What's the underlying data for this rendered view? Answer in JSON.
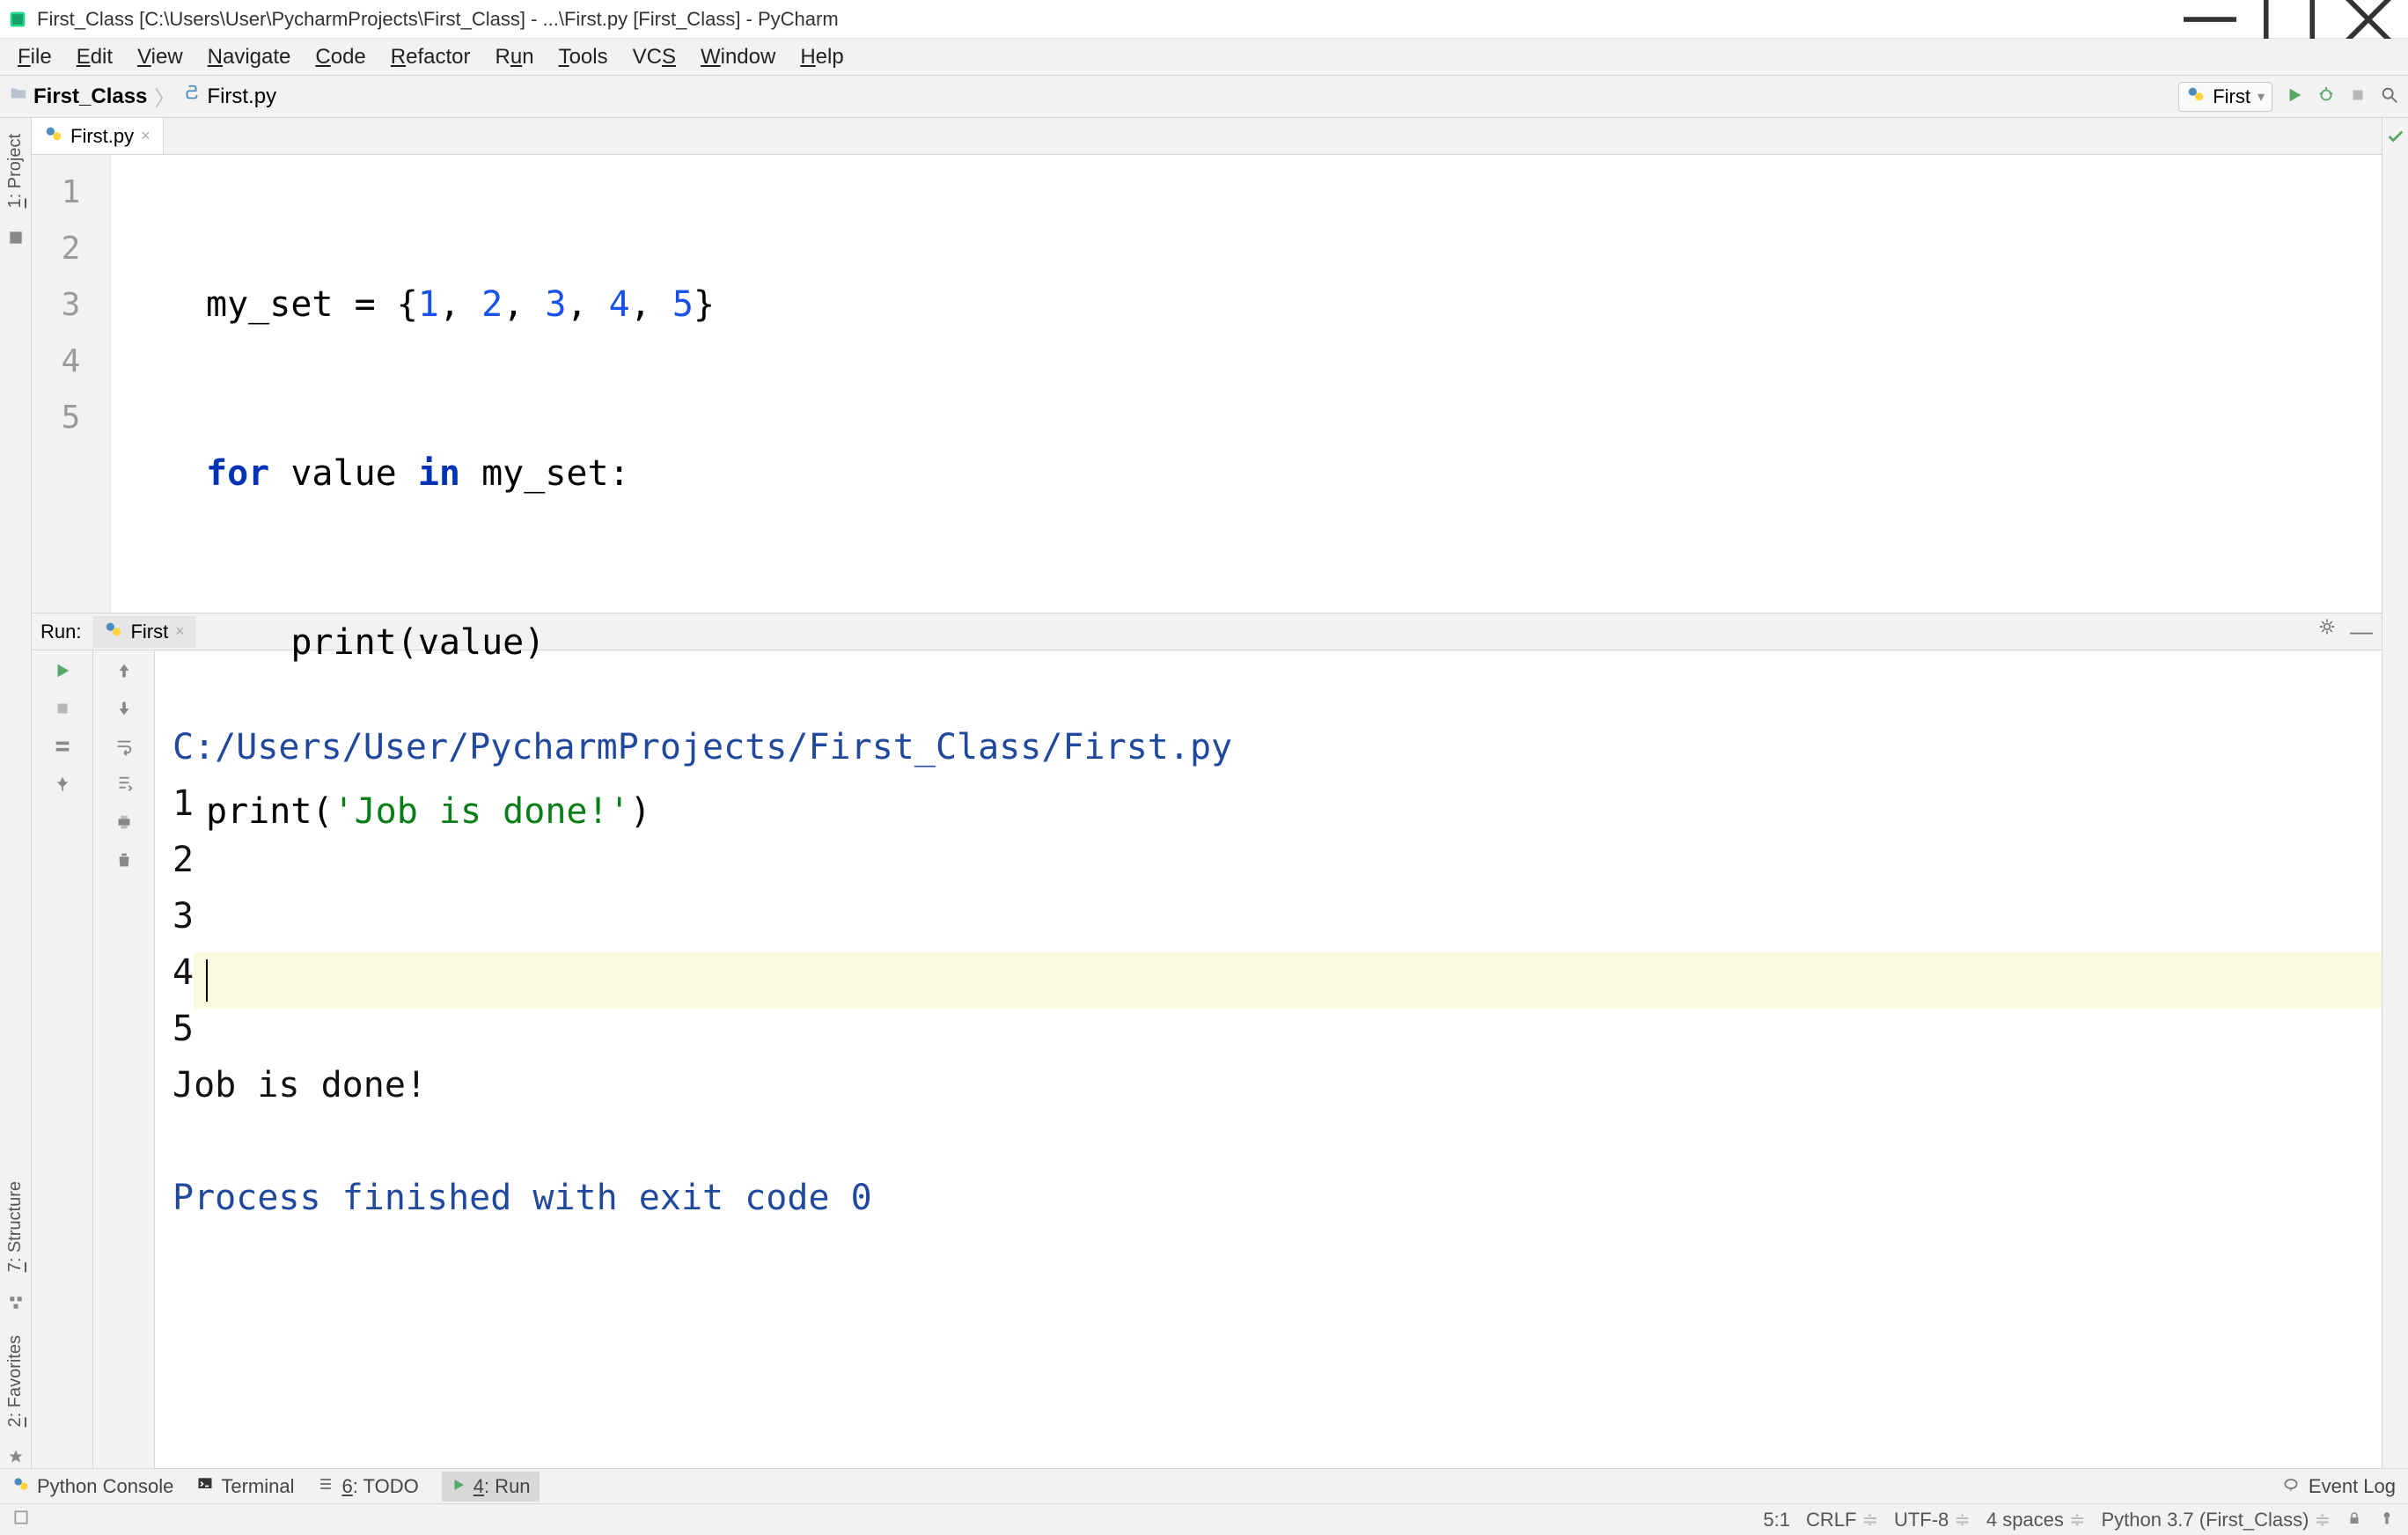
{
  "window": {
    "title": "First_Class [C:\\Users\\User\\PycharmProjects\\First_Class] - ...\\First.py [First_Class] - PyCharm"
  },
  "menu": {
    "file": "File",
    "edit": "Edit",
    "view": "View",
    "navigate": "Navigate",
    "code": "Code",
    "refactor": "Refactor",
    "run": "Run",
    "tools": "Tools",
    "vcs": "VCS",
    "window": "Window",
    "help": "Help"
  },
  "breadcrumb": {
    "project": "First_Class",
    "file": "First.py"
  },
  "run_config": {
    "name": "First"
  },
  "left_tabs": {
    "project": "1: Project",
    "structure": "7: Structure",
    "favorites": "2: Favorites"
  },
  "editor": {
    "tab": "First.py",
    "lines": {
      "n1": "1",
      "n2": "2",
      "n3": "3",
      "n4": "4",
      "n5": "5"
    },
    "code": {
      "l1_a": "my_set = {",
      "l1_n1": "1",
      "l1_c": ", ",
      "l1_n2": "2",
      "l1_n3": "3",
      "l1_n4": "4",
      "l1_n5": "5",
      "l1_b": "}",
      "l2_for": "for",
      "l2_val": " value ",
      "l2_in": "in",
      "l2_rest": " my_set:",
      "l3": "    print(value)",
      "l4_a": "print(",
      "l4_s": "'Job is done!'",
      "l4_b": ")"
    }
  },
  "run_panel": {
    "label": "Run:",
    "tab": "First",
    "output": {
      "path": "C:/Users/User/PycharmProjects/First_Class/First.py",
      "o1": "1",
      "o2": "2",
      "o3": "3",
      "o4": "4",
      "o5": "5",
      "o6": "Job is done!",
      "proc": "Process finished with exit code 0"
    }
  },
  "bottom": {
    "python_console": "Python Console",
    "terminal": "Terminal",
    "todo": "6: TODO",
    "run": "4: Run",
    "event_log": "Event Log"
  },
  "status": {
    "pos": "5:1",
    "line_sep": "CRLF",
    "encoding": "UTF-8",
    "indent": "4 spaces",
    "interpreter": "Python 3.7 (First_Class)"
  }
}
